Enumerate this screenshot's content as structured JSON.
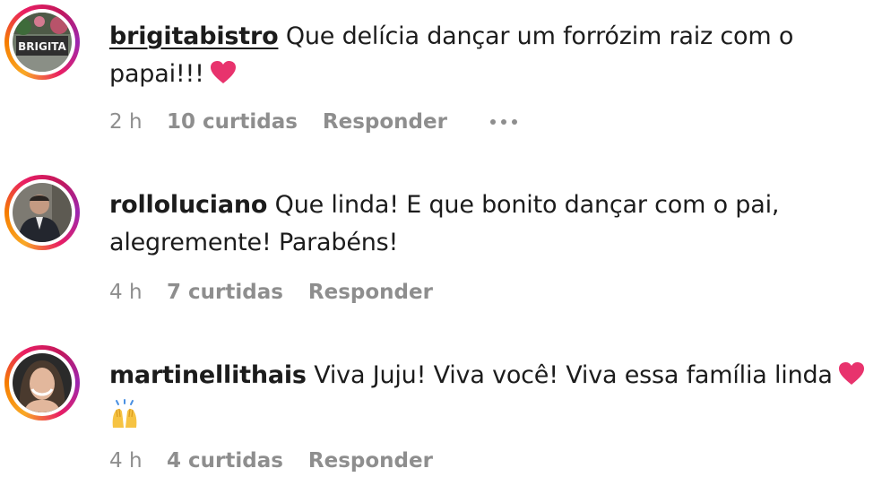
{
  "comments": [
    {
      "username": "brigitabistro",
      "text_line1": "Que delícia dançar um forrózim raiz com o",
      "text_line2": "papai!!!",
      "emoji": "heart-icon",
      "time": "2 h",
      "likes": "10 curtidas",
      "reply": "Responder",
      "avatar_sign_text": "BRIGITA"
    },
    {
      "username": "rolloluciano",
      "text_line1": "Que linda! E que bonito dançar com o pai,",
      "text_line2": "alegremente! Parabéns!",
      "time": "4 h",
      "likes": "7 curtidas",
      "reply": "Responder"
    },
    {
      "username": "martinellithais",
      "text_line1": "Viva Juju! Viva você! Viva essa família linda",
      "emoji1": "heart-icon",
      "emoji2": "raising-hands-icon",
      "time": "4 h",
      "likes": "4 curtidas",
      "reply": "Responder"
    }
  ],
  "colors": {
    "text": "#1c1c1c",
    "meta": "#8e8e8e",
    "heart": "#e8336d"
  }
}
